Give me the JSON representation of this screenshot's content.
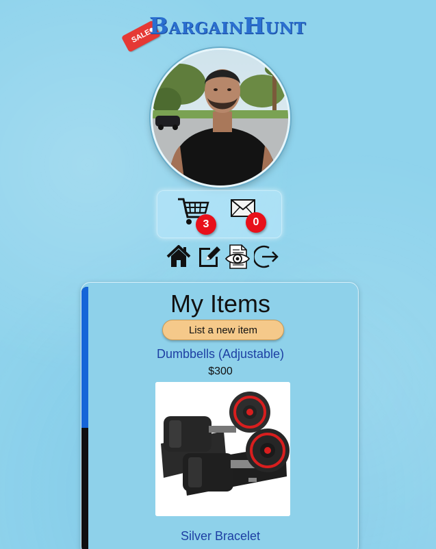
{
  "brand": {
    "name": "BargainHunt",
    "tag": "SALE"
  },
  "profile": {
    "avatar_icon": "user-avatar-photo"
  },
  "counters": {
    "cart_count": "3",
    "message_count": "0"
  },
  "nav": [
    {
      "icon": "home-icon"
    },
    {
      "icon": "edit-icon"
    },
    {
      "icon": "view-document-icon"
    },
    {
      "icon": "logout-icon"
    }
  ],
  "panel": {
    "title": "My Items",
    "list_button": "List a new item",
    "items": [
      {
        "name": "Dumbbells (Adjustable)",
        "price": "$300",
        "image_icon": "dumbbells-image"
      },
      {
        "name": "Silver Bracelet"
      }
    ]
  },
  "colors": {
    "background": "#8fd3ec",
    "brand": "#2a6fd0",
    "badge": "#e8101a",
    "button": "#f5c98a",
    "item_name": "#1d3fa3",
    "scroll_thumb": "#1565d8"
  }
}
